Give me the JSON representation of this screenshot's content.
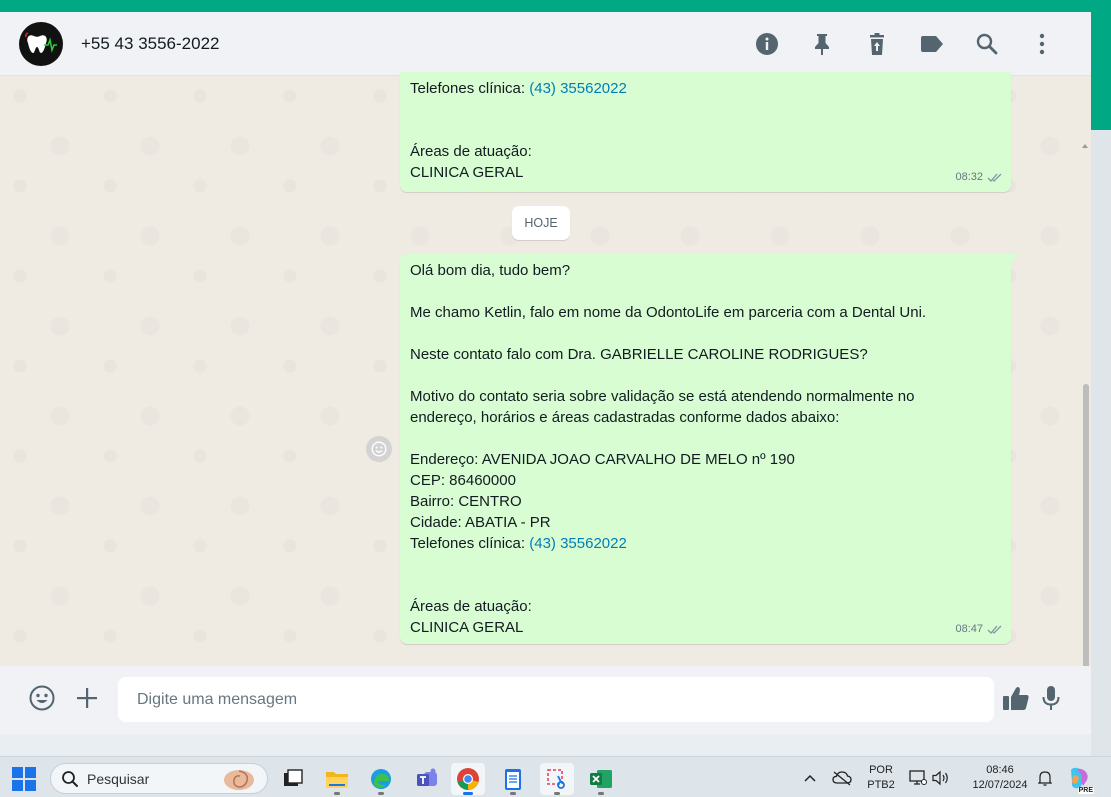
{
  "header": {
    "contact_name": "+55 43 3556-2022",
    "icons": [
      "info-icon",
      "pin-icon",
      "delete-icon",
      "label-icon",
      "search-icon",
      "menu-icon"
    ]
  },
  "messages": [
    {
      "id": "msg1",
      "lines": [
        {
          "text": "Telefones clínica: ",
          "link": "(43) 35562022"
        },
        {
          "text": ""
        },
        {
          "text": ""
        },
        {
          "text": "Áreas de atuação:"
        },
        {
          "text": "CLINICA GERAL"
        }
      ],
      "time": "08:32",
      "status": "read"
    },
    {
      "id": "msg2",
      "lines": [
        {
          "text": "Olá bom dia, tudo bem?"
        },
        {
          "text": ""
        },
        {
          "text": "Me chamo Ketlin, falo em nome da OdontoLife em parceria com a Dental Uni."
        },
        {
          "text": ""
        },
        {
          "text": "Neste contato falo com Dra. GABRIELLE CAROLINE RODRIGUES?"
        },
        {
          "text": ""
        },
        {
          "text": "Motivo do contato seria sobre validação se está atendendo normalmente no"
        },
        {
          "text": "endereço, horários e áreas cadastradas conforme dados abaixo:"
        },
        {
          "text": ""
        },
        {
          "text": "Endereço: AVENIDA JOAO CARVALHO DE MELO nº 190"
        },
        {
          "text": "CEP: 86460000"
        },
        {
          "text": "Bairro: CENTRO"
        },
        {
          "text": "Cidade: ABATIA - PR"
        },
        {
          "text": "Telefones clínica: ",
          "link": "(43) 35562022"
        },
        {
          "text": ""
        },
        {
          "text": ""
        },
        {
          "text": "Áreas de atuação:"
        },
        {
          "text": "CLINICA GERAL"
        }
      ],
      "time": "08:47",
      "status": "read"
    }
  ],
  "date_divider": "HOJE",
  "composer": {
    "placeholder": "Digite uma mensagem"
  },
  "taskbar": {
    "search_label": "Pesquisar",
    "lang_line1": "POR",
    "lang_line2": "PTB2",
    "time": "08:46",
    "date": "12/07/2024",
    "apps": [
      "task-view",
      "file-explorer",
      "edge",
      "teams",
      "chrome",
      "notepad",
      "snipping-tool",
      "excel"
    ],
    "copilot_badge": "PRE"
  },
  "colors": {
    "accent": "#00a884",
    "outgoing_bubble": "#d9fdd3",
    "link": "#027eb5",
    "chat_bg": "#efeae2"
  }
}
